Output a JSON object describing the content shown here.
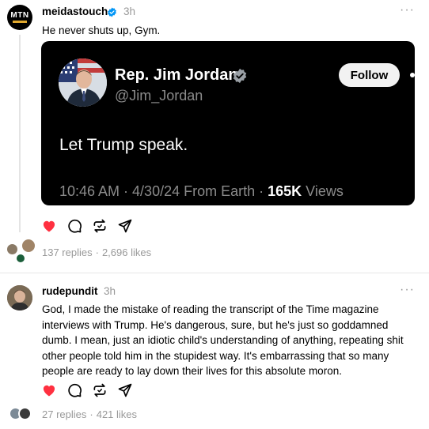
{
  "post1": {
    "username": "meidastouch",
    "time": "3h",
    "avatar_text": "MTN",
    "text": "He never shuts up, Gym.",
    "embed": {
      "name": "Rep. Jim Jordan",
      "handle": "@Jim_Jordan",
      "follow_label": "Follow",
      "text": "Let Trump speak.",
      "meta_prefix": "10:46 AM · 4/30/24 From Earth · ",
      "views_count": "165K",
      "views_label": " Views"
    },
    "replies": "137 replies",
    "likes": "2,696 likes",
    "liked": true
  },
  "post2": {
    "username": "rudepundit",
    "time": "3h",
    "text": "God, I made the mistake of reading the transcript of the Time magazine\ninterviews with Trump. He's dangerous, sure, but he's just so goddamned\ndumb. I mean, just an idiotic child's understanding of anything, repeating shit\nother people told him in the stupidest way. It's embarrassing that so many\npeople are ready to lay down their lives for this absolute moron.",
    "replies": "27 replies",
    "likes": "421 likes",
    "liked": true
  },
  "stat_separator": "·",
  "icons": {
    "like": "heart-icon",
    "reply": "comment-icon",
    "repost": "repost-icon",
    "share": "send-icon",
    "verified": "verified-badge-icon",
    "more": "more-options-icon"
  },
  "colors": {
    "like_red": "#ff3040",
    "verified_blue": "#0095f6",
    "secondary_text": "#999999"
  }
}
